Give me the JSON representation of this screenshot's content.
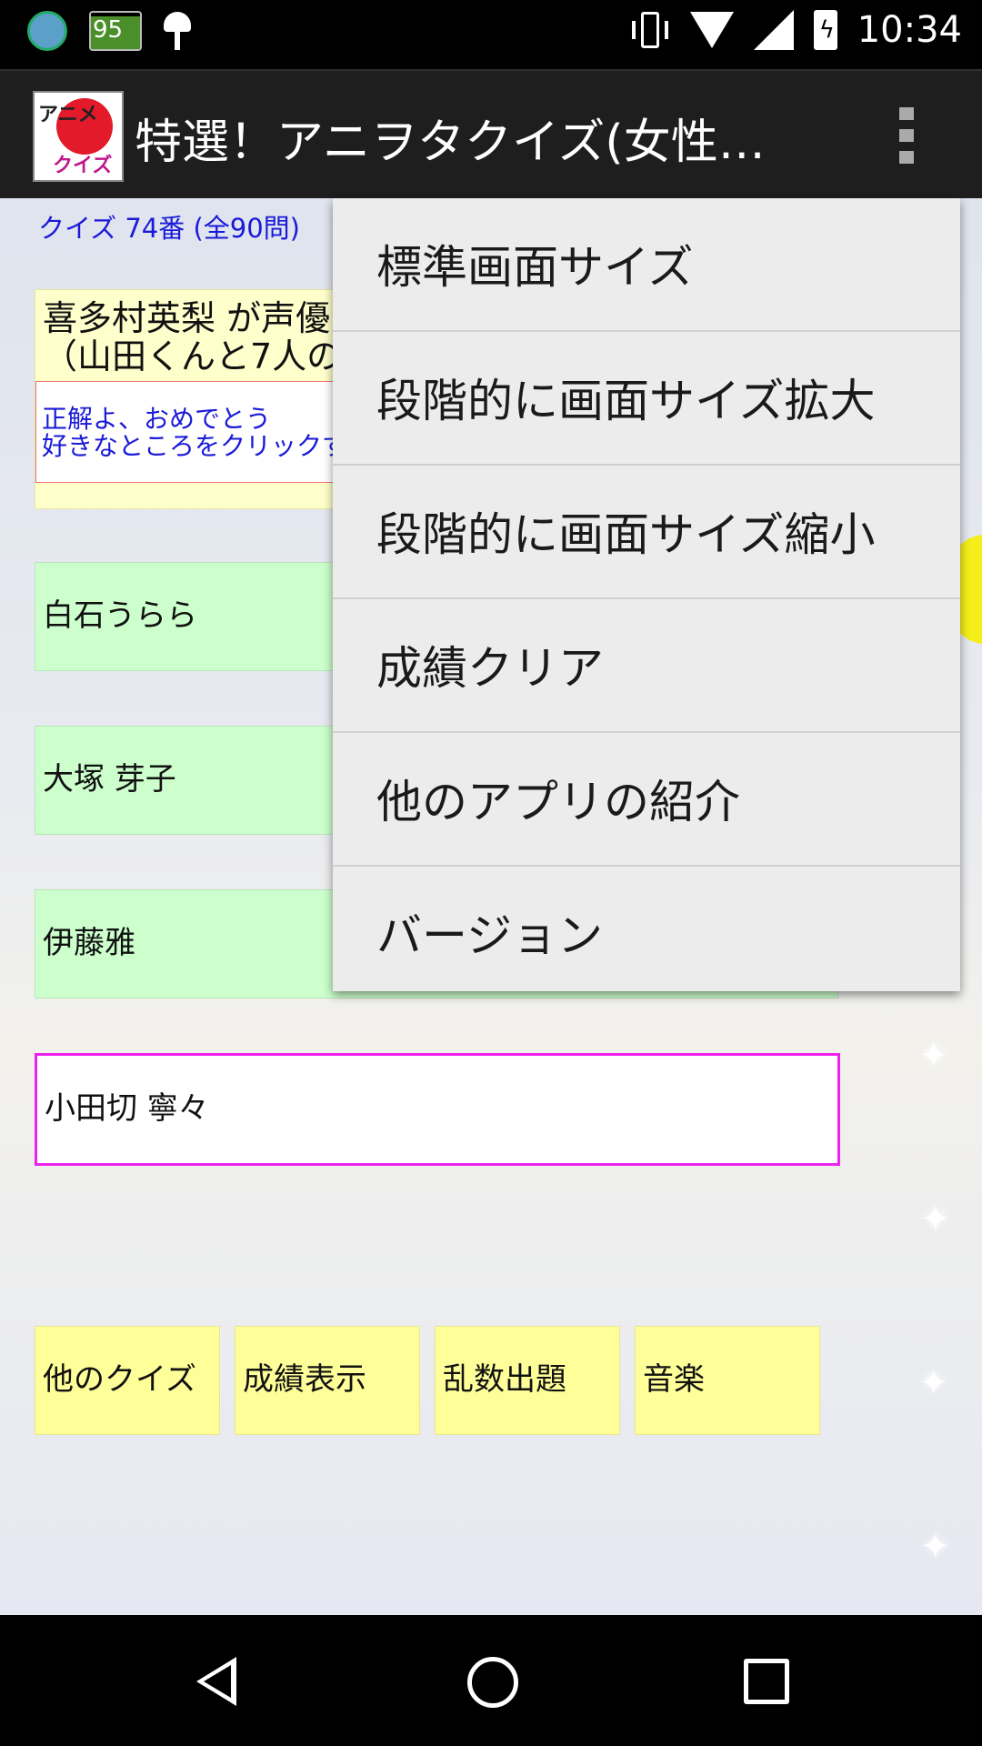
{
  "status_bar": {
    "battery_level": "95",
    "time": "10:34"
  },
  "action_bar": {
    "title": "特選！アニヲタクイズ(女性…",
    "icon_text_top": "アニメ",
    "icon_text_bottom": "クイズ"
  },
  "quiz": {
    "number_label": "クイズ 74番 (全90問)",
    "question_line1": "喜多村英梨 が声優",
    "question_line2": "（山田くんと7人の",
    "feedback_line1": "正解よ、おめでとう",
    "feedback_line2": "好きなところをクリックす"
  },
  "choices": [
    {
      "label": "白石うらら"
    },
    {
      "label": "大塚 芽子"
    },
    {
      "label": "伊藤雅"
    },
    {
      "label": "小田切 寧々"
    }
  ],
  "buttons": {
    "other_quiz": "他のクイズ",
    "score": "成績表示",
    "random": "乱数出題",
    "music": "音楽"
  },
  "menu": {
    "items": [
      {
        "label": "標準画面サイズ"
      },
      {
        "label": "段階的に画面サイズ拡大"
      },
      {
        "label": "段階的に画面サイズ縮小"
      },
      {
        "label": "成績クリア"
      },
      {
        "label": "他のアプリの紹介"
      },
      {
        "label": "バージョン"
      }
    ]
  }
}
